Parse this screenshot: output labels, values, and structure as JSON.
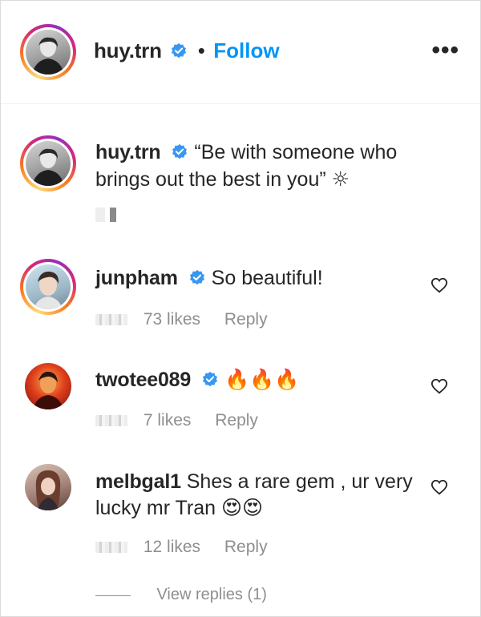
{
  "header": {
    "username": "huy.trn",
    "separator": "•",
    "follow_label": "Follow",
    "more_label": "•••"
  },
  "caption": {
    "username": "huy.trn",
    "text": "“Be with someone who brings out the best in you”",
    "emoji": "☼"
  },
  "comments": [
    {
      "username": "junpham",
      "verified": true,
      "text": "So beautiful!",
      "likes": "73 likes",
      "reply": "Reply"
    },
    {
      "username": "twotee089",
      "verified": true,
      "text": "🔥🔥🔥",
      "likes": "7 likes",
      "reply": "Reply"
    },
    {
      "username": "melbgal1",
      "verified": false,
      "text": "Shes a rare gem , ur very lucky mr Tran 😍😍",
      "likes": "12 likes",
      "reply": "Reply"
    }
  ],
  "view_replies": "View replies (1)",
  "colors": {
    "link": "#0095f6",
    "text": "#262626",
    "muted": "#8e8e8e",
    "verified": "#3897f0"
  },
  "icons": [
    "verified-badge-icon",
    "more-options-icon",
    "heart-icon"
  ]
}
